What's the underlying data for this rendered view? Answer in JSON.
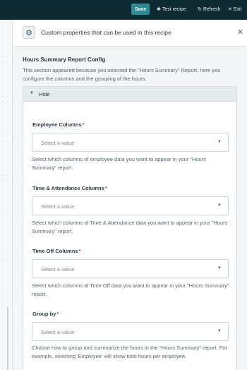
{
  "topbar": {
    "save_label": "Save",
    "test_label": "Test recipe",
    "refresh_label": "Refresh",
    "exit_label": "Exit",
    "icons": {
      "test": "gear-icon",
      "refresh": "refresh-icon",
      "exit": "close-icon"
    }
  },
  "custom_props": {
    "title": "Custom properties that can be used in this recipe",
    "icon": "gear-icon",
    "close_icon": "close-icon"
  },
  "section": {
    "title": "Hours Summary Report Config",
    "description": "This section appeared because you selected the \"Hours Summary\" Report, here you configure the columns and the grouping of the hours.",
    "toggle_label": "Hide"
  },
  "fields": [
    {
      "label": "Employee Columns",
      "required_mark": "*",
      "placeholder": "Select a value",
      "hint": "Select which columns of employee data you want to appear in your \"Hours Summary\" report."
    },
    {
      "label": "Time & Attendance Columns",
      "required_mark": "*",
      "placeholder": "Select a value",
      "hint": "Select which columns of Time & Attendance data you want to appear in your \"Hours Summary\" report."
    },
    {
      "label": "Time Off Columns",
      "required_mark": "*",
      "placeholder": "Select a value",
      "hint": "Select which columns of Time Off data you want to appear in your \"Hours Summary\" report."
    },
    {
      "label": "Group by",
      "required_mark": "*",
      "placeholder": "Select a value",
      "hint": "Choose how to group and summarize the hours in the \"Hours Summary\" report. For example, selecting 'Employee' will show total hours per employee."
    }
  ],
  "colors": {
    "topbar": "#0e2b33",
    "save_button": "#2b8c96",
    "required": "#d23a3a"
  }
}
